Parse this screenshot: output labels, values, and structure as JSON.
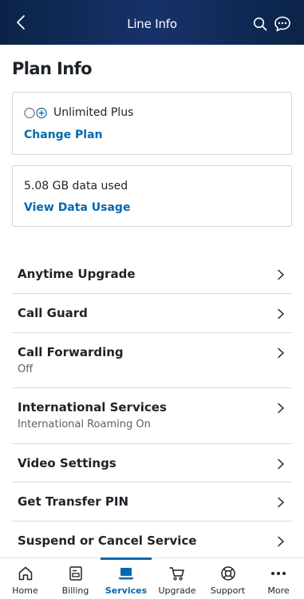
{
  "header": {
    "title": "Line Info",
    "icons": {
      "back": "chevron-left-icon",
      "search": "search-icon",
      "chat": "chat-bubble-icon"
    }
  },
  "page": {
    "title": "Plan Info"
  },
  "plan_card": {
    "plan_name": "Unlimited Plus",
    "change_link": "Change Plan",
    "plan_icon": "plan-toggle-icon"
  },
  "data_card": {
    "usage_text": "5.08 GB data used",
    "view_link": "View Data Usage"
  },
  "services": [
    {
      "label": "Anytime Upgrade",
      "sub": ""
    },
    {
      "label": "Call Guard",
      "sub": ""
    },
    {
      "label": "Call Forwarding",
      "sub": "Off"
    },
    {
      "label": "International Services",
      "sub": "International Roaming On"
    },
    {
      "label": "Video Settings",
      "sub": ""
    },
    {
      "label": "Get Transfer PIN",
      "sub": ""
    },
    {
      "label": "Suspend or Cancel Service",
      "sub": ""
    }
  ],
  "tabbar": {
    "tabs": [
      {
        "label": "Home",
        "icon": "home-icon"
      },
      {
        "label": "Billing",
        "icon": "bill-icon"
      },
      {
        "label": "Services",
        "icon": "laptop-icon"
      },
      {
        "label": "Upgrade",
        "icon": "cart-icon"
      },
      {
        "label": "Support",
        "icon": "lifebuoy-icon"
      },
      {
        "label": "More",
        "icon": "more-dots-icon"
      }
    ],
    "active": "Services"
  },
  "colors": {
    "header_bg": "#0b2347",
    "link": "#0568ae",
    "text": "#1d2329",
    "subtext": "#5a5f64",
    "divider": "#d6d9dd"
  }
}
